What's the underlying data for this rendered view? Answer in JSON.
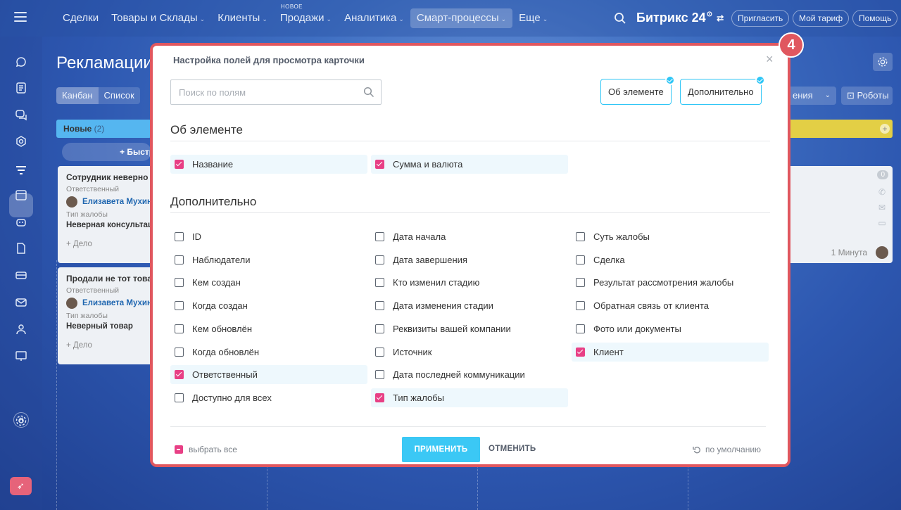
{
  "topbar": {
    "nav": [
      {
        "label": "Сделки",
        "chevron": false,
        "active": false,
        "badge": ""
      },
      {
        "label": "Товары и Склады",
        "chevron": true,
        "active": false,
        "badge": ""
      },
      {
        "label": "Клиенты",
        "chevron": true,
        "active": false,
        "badge": ""
      },
      {
        "label": "Продажи",
        "chevron": true,
        "active": false,
        "badge": "НОВОЕ"
      },
      {
        "label": "Аналитика",
        "chevron": true,
        "active": false,
        "badge": ""
      },
      {
        "label": "Смарт-процессы",
        "chevron": true,
        "active": true,
        "badge": ""
      },
      {
        "label": "Еще",
        "chevron": true,
        "active": false,
        "badge": ""
      }
    ],
    "brand": "Битрикс 24",
    "invite": "Пригласить",
    "tariff": "Мой тариф",
    "help": "Помощь"
  },
  "page": {
    "title": "Рекламации",
    "views": [
      "Канбан",
      "Список"
    ],
    "partial_tool_label": "ения",
    "robots": "Роботы"
  },
  "kanban": {
    "stage_new": {
      "name": "Новые",
      "count": "(2)"
    },
    "quick_add": "+ Быстрое",
    "cards": [
      {
        "title": "Сотрудник неверно проконсультировал",
        "resp_label": "Ответственный",
        "user": "Елизавета Мухина",
        "type_label": "Тип жалобы",
        "type_value": "Неверная консультация",
        "deal": "+ Дело"
      },
      {
        "title": "Продали не тот товар",
        "resp_label": "Ответственный",
        "user": "Елизавета Мухина",
        "type_label": "Тип жалобы",
        "type_value": "Неверный товар",
        "deal": "+ Дело"
      }
    ],
    "right_card": {
      "counter": "0",
      "time": "1 Минута"
    }
  },
  "modal": {
    "step": "4",
    "title": "Настройка полей для просмотра карточки",
    "search_placeholder": "Поиск по полям",
    "filter_tags": [
      "Об элементе",
      "Дополнительно"
    ],
    "sections": [
      {
        "title": "Об элементе",
        "fields": [
          {
            "label": "Название",
            "checked": true
          },
          {
            "label": "Сумма и валюта",
            "checked": true
          }
        ]
      },
      {
        "title": "Дополнительно",
        "columns": [
          [
            {
              "label": "ID",
              "checked": false
            },
            {
              "label": "Наблюдатели",
              "checked": false
            },
            {
              "label": "Кем создан",
              "checked": false
            },
            {
              "label": "Когда создан",
              "checked": false
            },
            {
              "label": "Кем обновлён",
              "checked": false
            },
            {
              "label": "Когда обновлён",
              "checked": false
            },
            {
              "label": "Ответственный",
              "checked": true
            },
            {
              "label": "Доступно для всех",
              "checked": false
            }
          ],
          [
            {
              "label": "Дата начала",
              "checked": false
            },
            {
              "label": "Дата завершения",
              "checked": false
            },
            {
              "label": "Кто изменил стадию",
              "checked": false
            },
            {
              "label": "Дата изменения стадии",
              "checked": false
            },
            {
              "label": "Реквизиты вашей компании",
              "checked": false
            },
            {
              "label": "Источник",
              "checked": false
            },
            {
              "label": "Дата последней коммуникации",
              "checked": false
            },
            {
              "label": "Тип жалобы",
              "checked": true
            }
          ],
          [
            {
              "label": "Суть жалобы",
              "checked": false
            },
            {
              "label": "Сделка",
              "checked": false
            },
            {
              "label": "Результат рассмотрения жалобы",
              "checked": false
            },
            {
              "label": "Обратная связь от клиента",
              "checked": false
            },
            {
              "label": "Фото или документы",
              "checked": false
            },
            {
              "label": "Клиент",
              "checked": true
            }
          ]
        ]
      }
    ],
    "select_all": "выбрать все",
    "apply": "ПРИМЕНИТЬ",
    "cancel": "ОТМЕНИТЬ",
    "reset": "по умолчанию"
  },
  "colors": {
    "accent": "#3bc8f5",
    "check": "#e83f85",
    "highlight": "#e0575f"
  }
}
